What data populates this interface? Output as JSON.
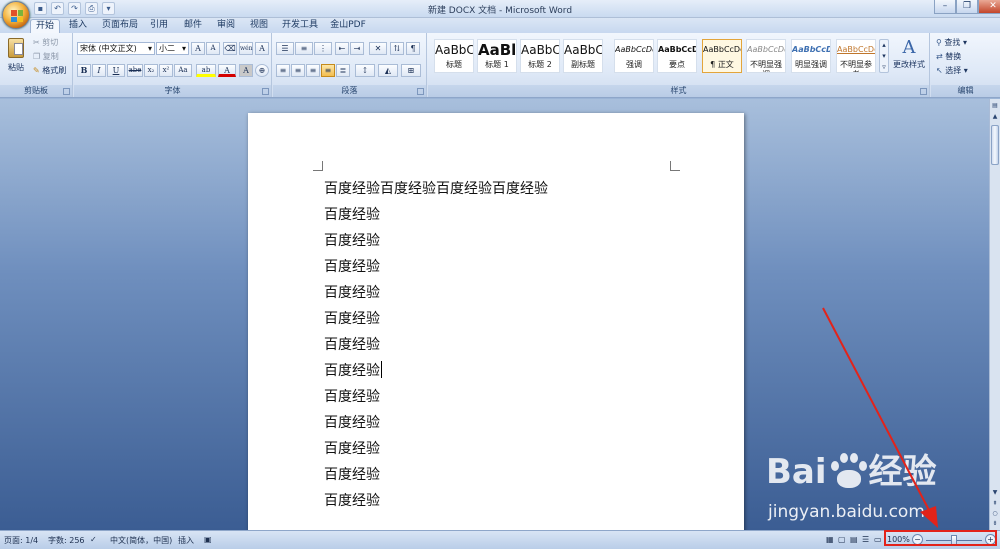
{
  "window": {
    "title": "新建 DOCX 文档 - Microsoft Word",
    "controls": [
      "minimize-icon",
      "restore-icon",
      "close-icon"
    ]
  },
  "quick_access": [
    "save-icon",
    "undo-icon",
    "redo-icon",
    "print-icon",
    "customize-icon"
  ],
  "tabs": [
    "开始",
    "插入",
    "页面布局",
    "引用",
    "邮件",
    "审阅",
    "视图",
    "开发工具",
    "金山PDF"
  ],
  "active_tab": "开始",
  "ribbon": {
    "clipboard": {
      "label": "剪贴板",
      "paste": "粘贴",
      "cut": "剪切",
      "copy": "复制",
      "format_painter": "格式刷"
    },
    "font": {
      "label": "字体",
      "font_name": "宋体 (中文正文)",
      "font_size": "小二",
      "grow": "A",
      "shrink": "A",
      "bold": "B",
      "italic": "I",
      "underline": "U",
      "strike": "abe",
      "subscript": "x₂",
      "superscript": "x²",
      "change_case": "Aa",
      "highlight": "ab",
      "font_color": "A",
      "char_shading": "A",
      "phonetic": "wén",
      "char_border": "A"
    },
    "paragraph": {
      "label": "段落"
    },
    "styles": {
      "label": "样式",
      "items": [
        {
          "sample": "AaBbC",
          "name": "标题"
        },
        {
          "sample": "AaBl",
          "name": "标题 1"
        },
        {
          "sample": "AaBbC",
          "name": "标题 2"
        },
        {
          "sample": "AaBbC",
          "name": "副标题"
        },
        {
          "sample": "AaBbCcDd",
          "name": "强调"
        },
        {
          "sample": "AaBbCcDd",
          "name": "要点"
        },
        {
          "sample": "AaBbCcDd",
          "name": "正文"
        },
        {
          "sample": "AaBbCcDd",
          "name": "不明显强调"
        },
        {
          "sample": "AaBbCcDd",
          "name": "明显强调"
        },
        {
          "sample": "AaBbCcDd",
          "name": "不明显参考"
        }
      ],
      "selected": "正文",
      "change_styles": "更改样式"
    },
    "editing": {
      "label": "编辑",
      "find": "查找",
      "replace": "替换",
      "select": "选择"
    }
  },
  "document": {
    "lines": [
      "百度经验百度经验百度经验百度经验",
      "百度经验",
      "百度经验",
      "百度经验",
      "百度经验",
      "百度经验",
      "百度经验",
      "百度经验",
      "百度经验",
      "百度经验",
      "百度经验",
      "百度经验",
      "百度经验"
    ],
    "caret_line": 7
  },
  "statusbar": {
    "page": "页面: 1/4",
    "words": "字数: 256",
    "language": "中文(简体，中国)",
    "insert_mode": "插入",
    "zoom": "100%"
  },
  "watermark": {
    "brand": "Bai",
    "brand2": "经验",
    "url": "jingyan.baidu.com"
  },
  "colors": {
    "highlight": "#ffff00",
    "font_color": "#d40000",
    "annotation": "#e2231a"
  }
}
